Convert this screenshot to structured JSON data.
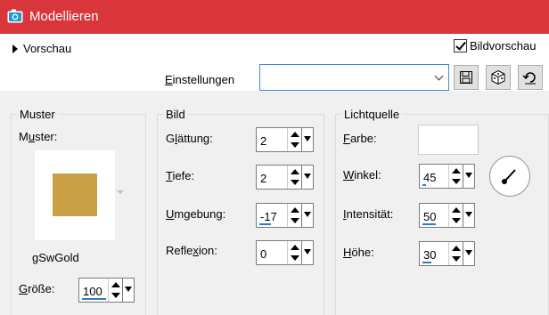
{
  "window": {
    "title": "Modellieren",
    "icon": "camera-icon"
  },
  "topbar": {
    "preview_label": "Vorschau",
    "bildvorschau_label": "Bildvorschau",
    "bildvorschau_checked": true,
    "einstellungen_label": "Einstellungen",
    "einstellungen_value": "",
    "buttons": [
      "save-icon",
      "dice-icon",
      "reset-icon"
    ]
  },
  "muster": {
    "group_title": "Muster",
    "pattern_label": "Muster:",
    "pattern_name": "gSwGold",
    "pattern_color": "#c9a045",
    "groesse_label": "Größe:",
    "groesse_value": "100",
    "groesse_level": 0.9
  },
  "bild": {
    "group_title": "Bild",
    "glaettung_label": "Glättung:",
    "glaettung_value": "2",
    "tiefe_label": "Tiefe:",
    "tiefe_value": "2",
    "umgebung_label": "Umgebung:",
    "umgebung_value": "-17",
    "umgebung_level": 0.41,
    "reflexion_label": "Reflexion:",
    "reflexion_value": "0"
  },
  "licht": {
    "group_title": "Lichtquelle",
    "farbe_label": "Farbe:",
    "farbe_value": "#ffffff",
    "winkel_label": "Winkel:",
    "winkel_value": "45",
    "winkel_level": 0.13,
    "intensitaet_label": "Intensität:",
    "intensitaet_value": "50",
    "intensitaet_level": 0.5,
    "hoehe_label": "Höhe:",
    "hoehe_value": "30",
    "hoehe_level": 0.33
  },
  "colors": {
    "titlebar": "#d9363c",
    "accent": "#2a7ad5"
  }
}
